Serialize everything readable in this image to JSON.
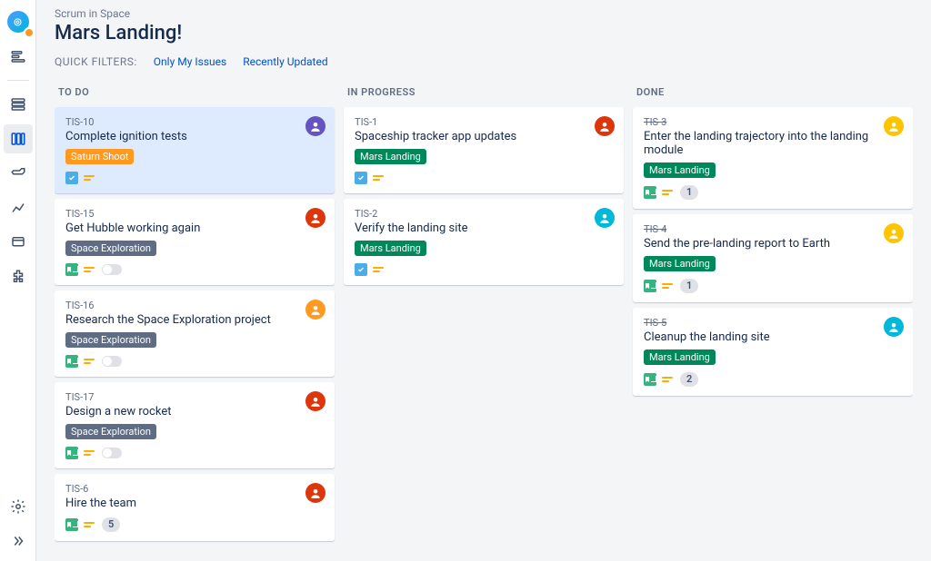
{
  "breadcrumb": "Scrum in Space",
  "title": "Mars Landing!",
  "filters": {
    "label": "QUICK FILTERS:",
    "links": [
      "Only My Issues",
      "Recently Updated"
    ]
  },
  "columns": [
    {
      "name": "TO DO",
      "cards": [
        {
          "key": "TIS-10",
          "title": "Complete ignition tests",
          "label": "Saturn Shoot",
          "labelColor": "orange",
          "type": "task",
          "avatar": "purple",
          "meta": "none",
          "highlighted": true
        },
        {
          "key": "TIS-15",
          "title": "Get Hubble working again",
          "label": "Space Exploration",
          "labelColor": "gray",
          "type": "story",
          "avatar": "red",
          "meta": "toggle"
        },
        {
          "key": "TIS-16",
          "title": "Research the Space Exploration project",
          "label": "Space Exploration",
          "labelColor": "gray",
          "type": "story",
          "avatar": "orange",
          "meta": "toggle"
        },
        {
          "key": "TIS-17",
          "title": "Design a new rocket",
          "label": "Space Exploration",
          "labelColor": "gray",
          "type": "story",
          "avatar": "red",
          "meta": "toggle"
        },
        {
          "key": "TIS-6",
          "title": "Hire the team",
          "label": null,
          "labelColor": null,
          "type": "story",
          "avatar": "red",
          "meta": "count",
          "count": "5"
        }
      ]
    },
    {
      "name": "IN PROGRESS",
      "cards": [
        {
          "key": "TIS-1",
          "title": "Spaceship tracker app updates",
          "label": "Mars Landing",
          "labelColor": "green",
          "type": "task",
          "avatar": "red",
          "meta": "none"
        },
        {
          "key": "TIS-2",
          "title": "Verify the landing site",
          "label": "Mars Landing",
          "labelColor": "green",
          "type": "task",
          "avatar": "teal",
          "meta": "none"
        }
      ]
    },
    {
      "name": "DONE",
      "cards": [
        {
          "key": "TIS-3",
          "title": "Enter the landing trajectory into the landing module",
          "label": "Mars Landing",
          "labelColor": "green",
          "type": "story",
          "avatar": "yellow",
          "meta": "count",
          "count": "1",
          "strike": true
        },
        {
          "key": "TIS-4",
          "title": "Send the pre-landing report to Earth",
          "label": "Mars Landing",
          "labelColor": "green",
          "type": "story",
          "avatar": "yellow",
          "meta": "count",
          "count": "1",
          "strike": true
        },
        {
          "key": "TIS-5",
          "title": "Cleanup the landing site",
          "label": "Mars Landing",
          "labelColor": "green",
          "type": "story",
          "avatar": "teal",
          "meta": "count",
          "count": "2",
          "strike": true
        }
      ]
    }
  ]
}
